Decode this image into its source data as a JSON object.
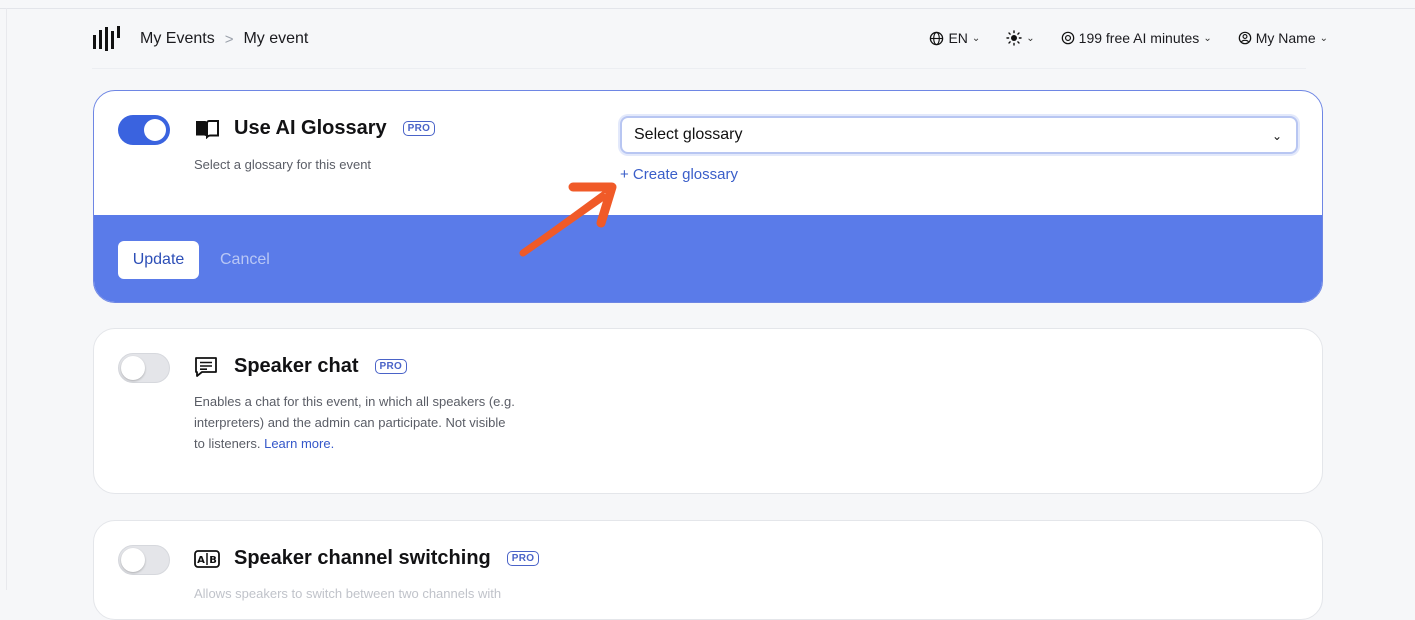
{
  "header": {
    "breadcrumb": [
      "My Events",
      "My event"
    ],
    "breadcrumb_separator": ">",
    "language": "EN",
    "ai_minutes": "199 free AI minutes",
    "user_name": "My Name"
  },
  "glossary": {
    "title": "Use AI Glossary",
    "badge": "PRO",
    "description": "Select a glossary for this event",
    "select_value": "Select glossary",
    "create_link": "+ Create glossary",
    "enabled": true,
    "update_label": "Update",
    "cancel_label": "Cancel"
  },
  "speaker_chat": {
    "title": "Speaker chat",
    "badge": "PRO",
    "desc_lines": [
      "Enables a chat for this event, in which all speakers (e.g.",
      "interpreters) and the admin can participate. Not visible"
    ],
    "desc_last": "to listeners. ",
    "learn_more": "Learn more.",
    "enabled": false
  },
  "channel_switching": {
    "title": "Speaker channel switching",
    "badge": "PRO",
    "desc_partial": "Allows speakers to switch between two channels with",
    "enabled": false
  },
  "colors": {
    "accent": "#5a7be9",
    "toggle_on": "#3a63df",
    "link": "#3a5ec9",
    "annotation_arrow": "#f05a28"
  }
}
